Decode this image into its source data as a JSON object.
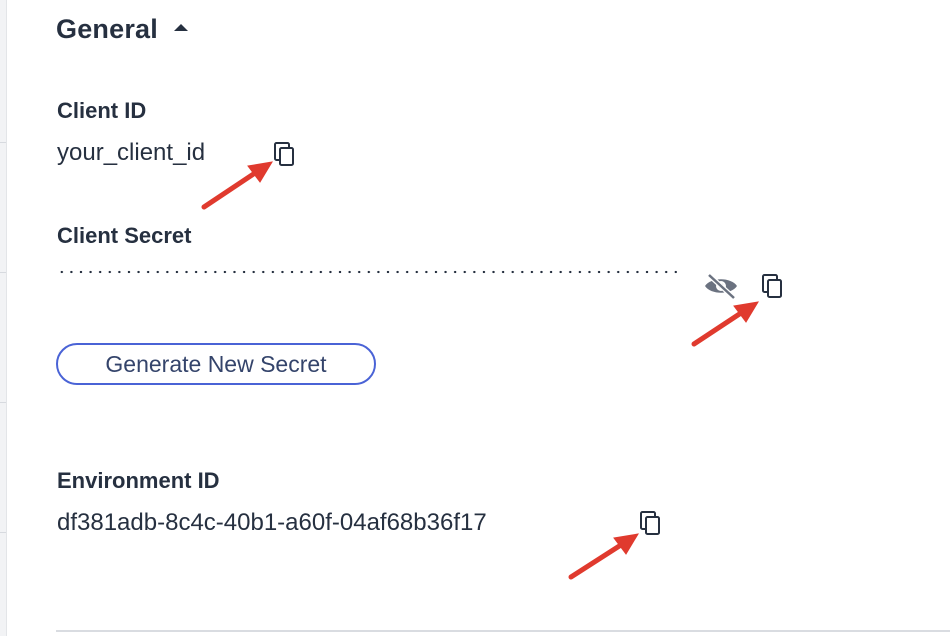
{
  "section": {
    "title": "General",
    "expanded": true
  },
  "client_id": {
    "label": "Client ID",
    "value": "your_client_id",
    "copy_icon": "copy-icon"
  },
  "client_secret": {
    "label": "Client Secret",
    "masked": true,
    "visibility_icon": "eye-off-icon",
    "copy_icon": "copy-icon"
  },
  "generate_button": {
    "label": "Generate New Secret"
  },
  "environment_id": {
    "label": "Environment ID",
    "value": "df381adb-8c4c-40b1-a60f-04af68b36f17",
    "copy_icon": "copy-icon"
  },
  "colors": {
    "text": "#263040",
    "button_border": "#4a63d6",
    "button_text": "#34446b",
    "annotation_arrow": "#e03a2e",
    "icon_grey": "#6b7280"
  }
}
